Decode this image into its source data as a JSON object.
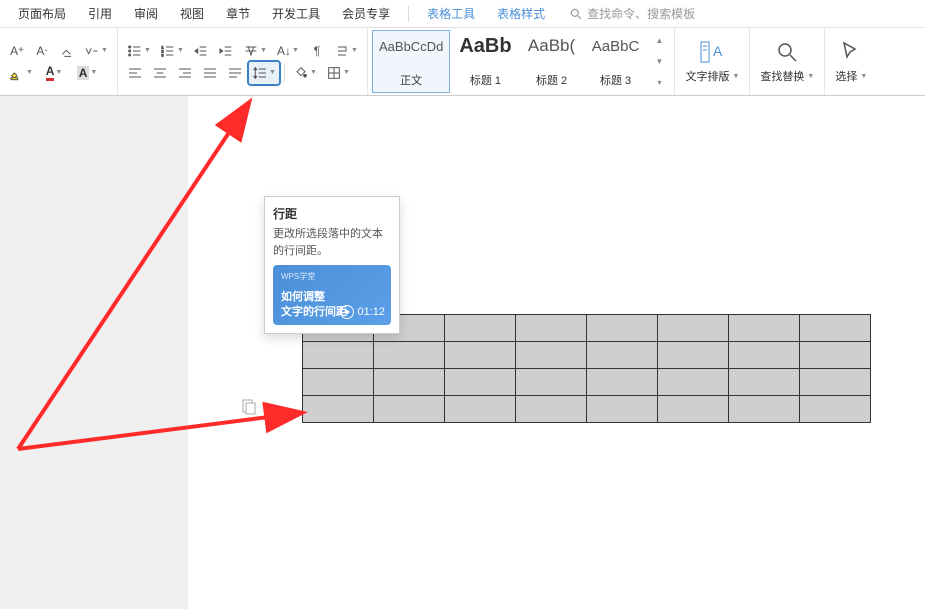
{
  "menu": {
    "items": [
      "页面布局",
      "引用",
      "审阅",
      "视图",
      "章节",
      "开发工具",
      "会员专享"
    ],
    "context_items": [
      "表格工具",
      "表格样式"
    ],
    "search_placeholder": "查找命令、搜索模板"
  },
  "styles": [
    {
      "preview": "AaBbCcDd",
      "label": "正文",
      "bold": false,
      "selected": true
    },
    {
      "preview": "AaBb",
      "label": "标题 1",
      "bold": true,
      "selected": false
    },
    {
      "preview": "AaBb(",
      "label": "标题 2",
      "bold": false,
      "selected": false
    },
    {
      "preview": "AaBbC",
      "label": "标题 3",
      "bold": false,
      "selected": false
    }
  ],
  "actions": {
    "layout": {
      "label": "文字排版"
    },
    "findreplace": {
      "label": "查找替换"
    },
    "select": {
      "label": "选择"
    }
  },
  "tooltip": {
    "title": "行距",
    "desc": "更改所选段落中的文本的行间距。",
    "video_tag": "WPS学堂",
    "video_title1": "如何调整",
    "video_title2": "文字的行间距",
    "video_time": "01:12"
  },
  "table": {
    "rows": 4,
    "cols": 8
  }
}
